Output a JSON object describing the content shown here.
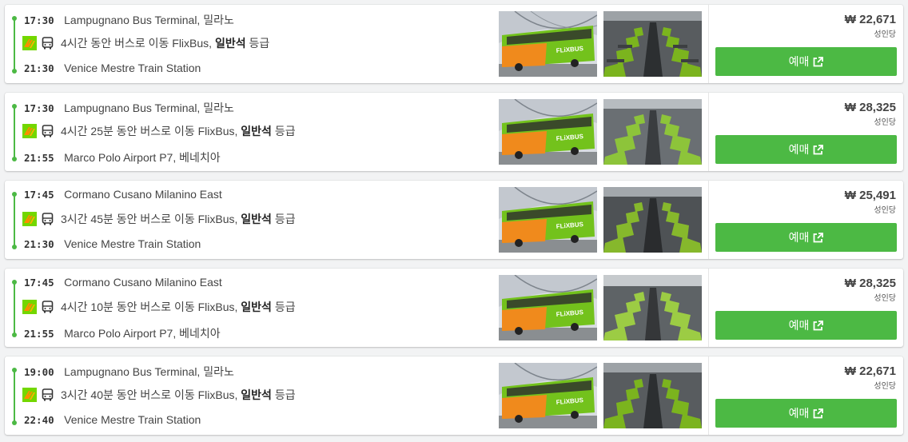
{
  "currency_symbol": "₩",
  "colors": {
    "accent": "#4cb944"
  },
  "trips": [
    {
      "dep_time": "17:30",
      "dep_station": "Lampugnano Bus Terminal, 밀라노",
      "duration_text": "4시간 동안 버스로 이동 FlixBus,",
      "class_name": "일반석",
      "class_suffix": "등급",
      "arr_time": "21:30",
      "arr_station": "Venice Mestre Train Station",
      "price": "₩ 22,671",
      "per_person": "성인당",
      "book_label": "예매"
    },
    {
      "dep_time": "17:30",
      "dep_station": "Lampugnano Bus Terminal, 밀라노",
      "duration_text": "4시간 25분 동안 버스로 이동 FlixBus,",
      "class_name": "일반석",
      "class_suffix": "등급",
      "arr_time": "21:55",
      "arr_station": "Marco Polo Airport P7, 베네치아",
      "price": "₩ 28,325",
      "per_person": "성인당",
      "book_label": "예매"
    },
    {
      "dep_time": "17:45",
      "dep_station": "Cormano Cusano Milanino East",
      "duration_text": "3시간 45분 동안 버스로 이동 FlixBus,",
      "class_name": "일반석",
      "class_suffix": "등급",
      "arr_time": "21:30",
      "arr_station": "Venice Mestre Train Station",
      "price": "₩ 25,491",
      "per_person": "성인당",
      "book_label": "예매"
    },
    {
      "dep_time": "17:45",
      "dep_station": "Cormano Cusano Milanino East",
      "duration_text": "4시간 10분 동안 버스로 이동 FlixBus,",
      "class_name": "일반석",
      "class_suffix": "등급",
      "arr_time": "21:55",
      "arr_station": "Marco Polo Airport P7, 베네치아",
      "price": "₩ 28,325",
      "per_person": "성인당",
      "book_label": "예매"
    },
    {
      "dep_time": "19:00",
      "dep_station": "Lampugnano Bus Terminal, 밀라노",
      "duration_text": "3시간 40분 동안 버스로 이동 FlixBus,",
      "class_name": "일반석",
      "class_suffix": "등급",
      "arr_time": "22:40",
      "arr_station": "Venice Mestre Train Station",
      "price": "₩ 22,671",
      "per_person": "성인당",
      "book_label": "예매"
    }
  ],
  "icons": {
    "operator": "flixbus-logo-icon",
    "transport": "bus-icon",
    "book": "external-link-icon",
    "photo_exterior": "bus-exterior-photo",
    "photo_interior": "bus-interior-photo"
  }
}
